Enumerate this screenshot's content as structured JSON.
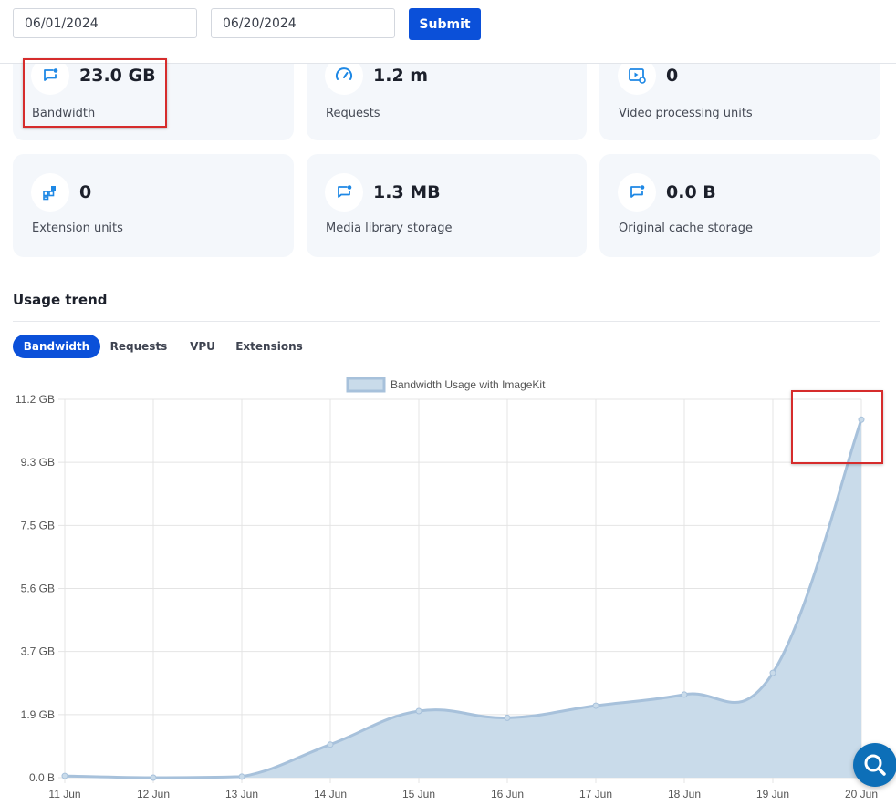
{
  "filters": {
    "start_date": "06/01/2024",
    "end_date": "06/20/2024",
    "submit_label": "Submit"
  },
  "cards": [
    {
      "value": "23.0 GB",
      "label": "Bandwidth",
      "icon": "chat-bubble-icon"
    },
    {
      "value": "1.2 m",
      "label": "Requests",
      "icon": "speedometer-icon"
    },
    {
      "value": "0",
      "label": "Video processing units",
      "icon": "video-gear-icon"
    },
    {
      "value": "0",
      "label": "Extension units",
      "icon": "grid-blocks-icon"
    },
    {
      "value": "1.3 MB",
      "label": "Media library storage",
      "icon": "chat-bubble-icon"
    },
    {
      "value": "0.0 B",
      "label": "Original cache storage",
      "icon": "chat-bubble-icon"
    }
  ],
  "trend": {
    "title": "Usage trend",
    "tabs": [
      "Bandwidth",
      "Requests",
      "VPU",
      "Extensions"
    ],
    "active_tab": "Bandwidth"
  },
  "colors": {
    "accent": "#0b50d9",
    "icon_blue": "#1e88e5",
    "area_fill": "#c9dbea",
    "area_line": "#a7c1db",
    "highlight": "#d62c2c"
  },
  "chart_data": {
    "type": "area",
    "legend": "Bandwidth Usage with ImageKit",
    "legend_position": "top",
    "x": [
      "11 Jun",
      "12 Jun",
      "13 Jun",
      "14 Jun",
      "15 Jun",
      "16 Jun",
      "17 Jun",
      "18 Jun",
      "19 Jun",
      "20 Jun"
    ],
    "y_ticks": [
      "0.0 B",
      "1.9 GB",
      "3.7 GB",
      "5.6 GB",
      "7.5 GB",
      "9.3 GB",
      "11.2 GB"
    ],
    "y_unit": "GB",
    "ylim": [
      0,
      11.2
    ],
    "series": [
      {
        "name": "Bandwidth Usage with ImageKit",
        "values": [
          0.05,
          0.0,
          0.03,
          0.98,
          1.97,
          1.77,
          2.13,
          2.46,
          3.1,
          10.6
        ]
      }
    ],
    "grid": true
  },
  "fab": {
    "icon": "search-icon"
  }
}
